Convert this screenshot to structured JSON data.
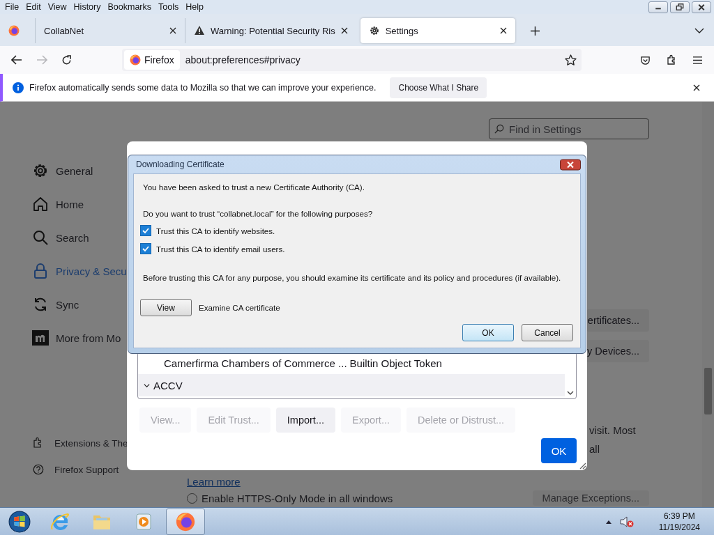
{
  "menu_bar": {
    "items": [
      "File",
      "Edit",
      "View",
      "History",
      "Bookmarks",
      "Tools",
      "Help"
    ]
  },
  "tabs": [
    {
      "title": "CollabNet",
      "kind": "site",
      "selected": false
    },
    {
      "title": "Warning: Potential Security Ris",
      "kind": "warning",
      "selected": false
    },
    {
      "title": "Settings",
      "kind": "settings",
      "selected": true
    }
  ],
  "nav": {
    "identity": "Firefox",
    "url": "about:preferences#privacy"
  },
  "notification": {
    "message": "Firefox automatically sends some data to Mozilla so that we can improve your experience.",
    "button": "Choose What I Share"
  },
  "sidebar": {
    "items": [
      {
        "label": "General",
        "kind": "general",
        "selected": false
      },
      {
        "label": "Home",
        "kind": "home",
        "selected": false
      },
      {
        "label": "Search",
        "kind": "search",
        "selected": false
      },
      {
        "label": "Privacy & Secu",
        "kind": "privacy",
        "selected": true
      },
      {
        "label": "Sync",
        "kind": "sync",
        "selected": false
      },
      {
        "label": "More from Mo",
        "kind": "more",
        "selected": false
      }
    ],
    "footer_items": [
      {
        "label": "Extensions & The",
        "kind": "extensions"
      },
      {
        "label": "Firefox Support",
        "kind": "support"
      }
    ]
  },
  "find": {
    "placeholder": "Find in Settings"
  },
  "content": {
    "buttons": [
      "ertificates...",
      "y Devices..."
    ],
    "text_lines": [
      "visit. Most",
      "all"
    ],
    "learn_more": "Learn more",
    "https_only": {
      "label": "Enable HTTPS-Only Mode in all windows",
      "selected": false
    },
    "exceptions_button": "Manage Exceptions..."
  },
  "certificate_manager": {
    "rows": [
      {
        "kind": "cert",
        "label": "Camerfirma Chambers of Commerce ...",
        "token": "Builtin Object Token"
      },
      {
        "kind": "group",
        "label": "ACCV",
        "expanded": true
      }
    ],
    "buttons": [
      {
        "label": "View...",
        "disabled": true
      },
      {
        "label": "Edit Trust...",
        "disabled": true
      },
      {
        "label": "Import...",
        "disabled": false
      },
      {
        "label": "Export...",
        "disabled": true
      },
      {
        "label": "Delete or Distrust...",
        "disabled": true
      }
    ],
    "ok": "OK"
  },
  "download_dialog": {
    "title": "Downloading Certificate",
    "intro": "You have been asked to trust a new Certificate Authority (CA).",
    "question": "Do you want to trust “collabnet.local” for the following purposes?",
    "options": [
      {
        "label": "Trust this CA to identify websites.",
        "checked": true
      },
      {
        "label": "Trust this CA to identify email users.",
        "checked": true
      }
    ],
    "advice": "Before trusting this CA for any purpose, you should examine its certificate and its policy and procedures (if available).",
    "view_button": "View",
    "view_caption": "Examine CA certificate",
    "buttons": [
      {
        "label": "OK",
        "default": true
      },
      {
        "label": "Cancel",
        "default": false
      }
    ]
  },
  "taskbar": {
    "apps": [
      {
        "kind": "ie",
        "selected": false
      },
      {
        "kind": "folder",
        "selected": false
      },
      {
        "kind": "media",
        "selected": false
      },
      {
        "kind": "firefox",
        "selected": true
      }
    ],
    "time": "6:39 PM",
    "date": "11/19/2024"
  }
}
